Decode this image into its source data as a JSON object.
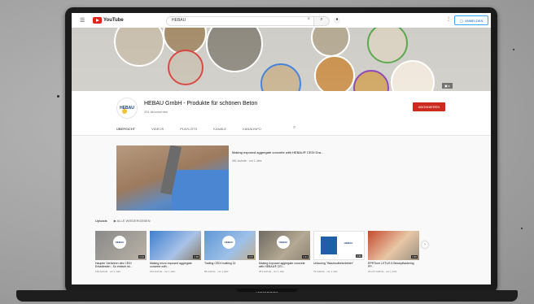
{
  "device": {
    "label": "Notebook"
  },
  "topbar": {
    "brand": "YouTube",
    "search_value": "HEBAU",
    "search_icon": "search-icon",
    "mic_icon": "mic-icon",
    "menu_icon": "menu-icon",
    "signin_label": "ANMELDEN"
  },
  "banner": {
    "colors": [
      "#d8403a",
      "#3b7dd8",
      "#8a3db5",
      "#57a84a"
    ]
  },
  "channel": {
    "logo_text": "HEBAU",
    "name": "HEBAU GmbH - Produkte für schönen Beton",
    "subscribers": "331 Abonnenten",
    "subscribe_label": "ABONNIEREN",
    "subscribe_color": "#cc2a1e"
  },
  "tabs": [
    {
      "label": "ÜBERSICHT"
    },
    {
      "label": "VIDEOS"
    },
    {
      "label": "PLAYLISTS"
    },
    {
      "label": "KANÄLE"
    },
    {
      "label": "KANALINFO"
    }
  ],
  "featured": {
    "title": "Making exposed aggregate concrete with HEBAU® CEDI Dra...",
    "meta": "361 Aufrufe · vor 1 Jahr"
  },
  "uploads": {
    "title": "Uploads",
    "play_all": "ALLE WIEDERGEBEN",
    "videos": [
      {
        "title": "Haupter Verfahren des CEDI Entadiesten - So einfach ist...",
        "meta": "139 Aufrufe · vor 1 Jahr",
        "duration": "2:24"
      },
      {
        "title": "Making micro exposed aggregate concrete with...",
        "meta": "181 Aufrufe · vor 1 Jahr",
        "duration": "1:38"
      },
      {
        "title": "Trailing CEDI multilog 3J",
        "meta": "98 Aufrufe · vor 1 Jahr",
        "duration": "1:07"
      },
      {
        "title": "Making exposed aggregate concrete with HEBAU® CEI...",
        "meta": "361 Aufrufe · vor 1 Jahr",
        "duration": "1:41"
      },
      {
        "title": "Unboxing \"Washoutbetonlekter\"",
        "meta": "79 Aufrufe · vor 1 Jahr",
        "duration": "1:32"
      },
      {
        "title": "EPRTurm LETUS 5 Betonpflastering PP...",
        "meta": "23.247 Aufrufe · vor 1 Jahr",
        "duration": "1:50"
      }
    ]
  }
}
